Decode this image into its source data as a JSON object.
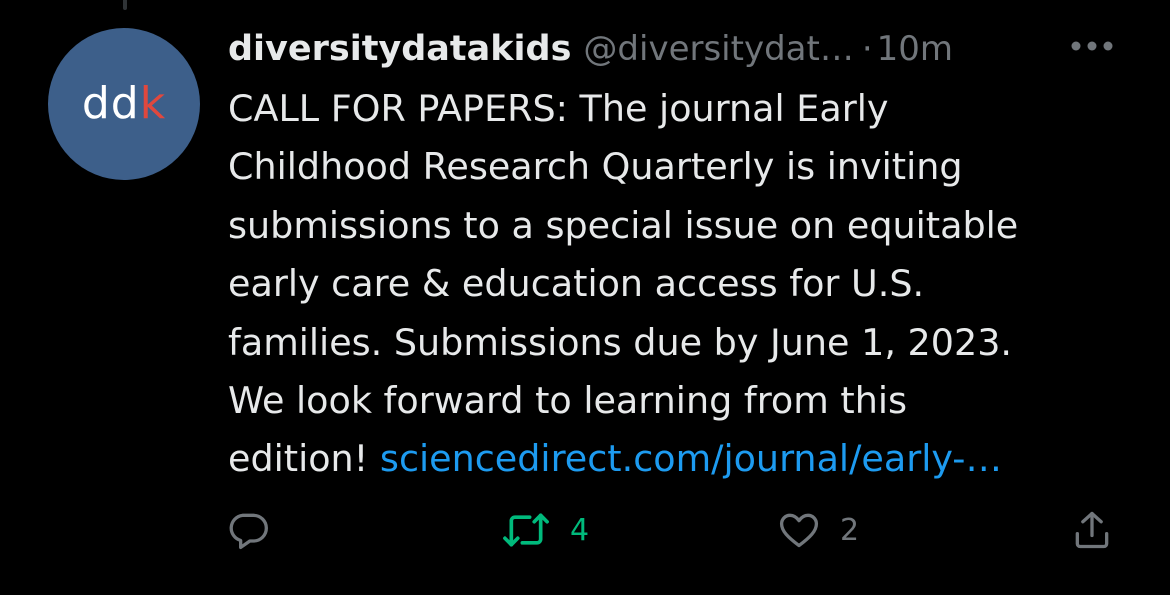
{
  "tweet": {
    "avatar": {
      "text_main": "dd",
      "text_accent": "k",
      "bg_color": "#3d5f8a",
      "accent_color": "#e0483e"
    },
    "author": {
      "display_name": "diversitydatakids",
      "handle": "@diversitydat…",
      "separator": "·",
      "time": "10m"
    },
    "body": {
      "lines": [
        "CALL FOR PAPERS: The journal Early",
        "Childhood Research Quarterly is inviting",
        "submissions to a special issue on equitable",
        "early care & education access for U.S.",
        "families. Submissions due by June 1, 2023.",
        "We look forward to learning from this"
      ],
      "last_line_prefix": "edition! ",
      "link_text": "sciencedirect.com/journal/early-…"
    },
    "actions": {
      "reply": {
        "icon": "reply-icon"
      },
      "retweet": {
        "icon": "retweet-icon",
        "count": "4",
        "color": "#00ba7c"
      },
      "like": {
        "icon": "heart-icon",
        "count": "2"
      },
      "share": {
        "icon": "share-icon"
      }
    },
    "colors": {
      "background": "#000000",
      "text": "#e7e9ea",
      "muted": "#71767b",
      "link": "#1d9bf0"
    }
  }
}
